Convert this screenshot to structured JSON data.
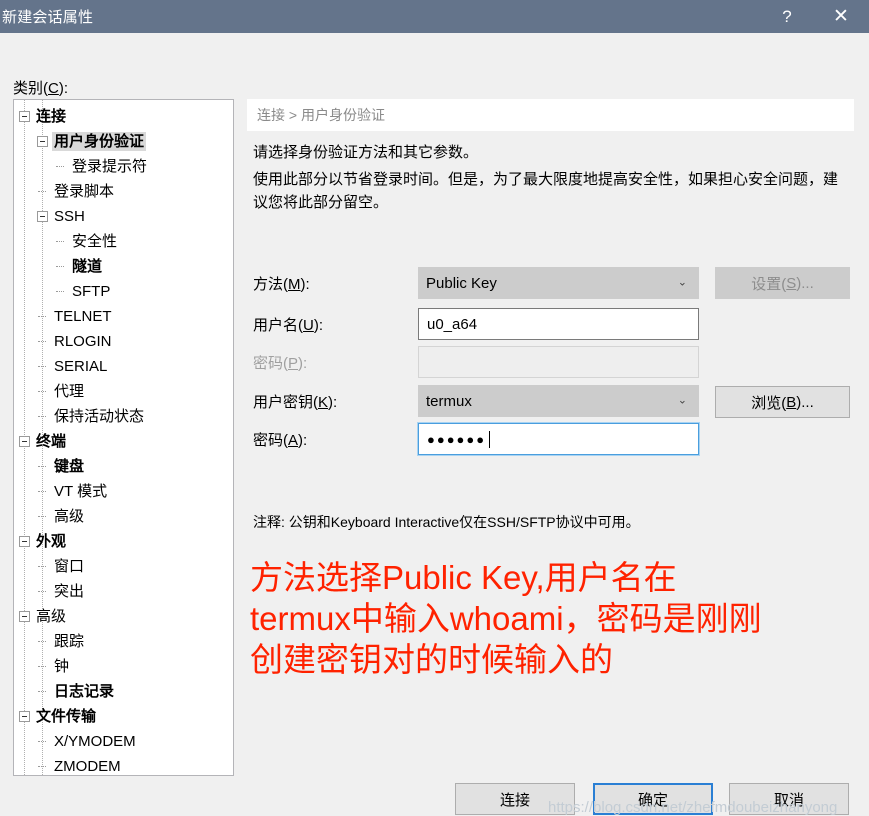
{
  "window": {
    "title": "新建会话属性",
    "help_button": "?",
    "close_button": "✕"
  },
  "category": {
    "label_prefix": "类别(",
    "label_accel": "C",
    "label_suffix": "):"
  },
  "tree": {
    "items": [
      {
        "label": "连接",
        "depth": 0,
        "expander": true,
        "bold": true,
        "selected": false
      },
      {
        "label": "用户身份验证",
        "depth": 1,
        "expander": true,
        "bold": true,
        "selected": true
      },
      {
        "label": "登录提示符",
        "depth": 2,
        "expander": false,
        "bold": false,
        "selected": false
      },
      {
        "label": "登录脚本",
        "depth": 1,
        "expander": false,
        "bold": false,
        "selected": false
      },
      {
        "label": "SSH",
        "depth": 1,
        "expander": true,
        "bold": false,
        "selected": false
      },
      {
        "label": "安全性",
        "depth": 2,
        "expander": false,
        "bold": false,
        "selected": false
      },
      {
        "label": "隧道",
        "depth": 2,
        "expander": false,
        "bold": true,
        "selected": false
      },
      {
        "label": "SFTP",
        "depth": 2,
        "expander": false,
        "bold": false,
        "selected": false
      },
      {
        "label": "TELNET",
        "depth": 1,
        "expander": false,
        "bold": false,
        "selected": false
      },
      {
        "label": "RLOGIN",
        "depth": 1,
        "expander": false,
        "bold": false,
        "selected": false
      },
      {
        "label": "SERIAL",
        "depth": 1,
        "expander": false,
        "bold": false,
        "selected": false
      },
      {
        "label": "代理",
        "depth": 1,
        "expander": false,
        "bold": false,
        "selected": false
      },
      {
        "label": "保持活动状态",
        "depth": 1,
        "expander": false,
        "bold": false,
        "selected": false
      },
      {
        "label": "终端",
        "depth": 0,
        "expander": true,
        "bold": true,
        "selected": false
      },
      {
        "label": "键盘",
        "depth": 1,
        "expander": false,
        "bold": true,
        "selected": false
      },
      {
        "label": "VT 模式",
        "depth": 1,
        "expander": false,
        "bold": false,
        "selected": false
      },
      {
        "label": "高级",
        "depth": 1,
        "expander": false,
        "bold": false,
        "selected": false
      },
      {
        "label": "外观",
        "depth": 0,
        "expander": true,
        "bold": true,
        "selected": false
      },
      {
        "label": "窗口",
        "depth": 1,
        "expander": false,
        "bold": false,
        "selected": false
      },
      {
        "label": "突出",
        "depth": 1,
        "expander": false,
        "bold": false,
        "selected": false
      },
      {
        "label": "高级",
        "depth": 0,
        "expander": true,
        "bold": false,
        "selected": false
      },
      {
        "label": "跟踪",
        "depth": 1,
        "expander": false,
        "bold": false,
        "selected": false
      },
      {
        "label": "钟",
        "depth": 1,
        "expander": false,
        "bold": false,
        "selected": false
      },
      {
        "label": "日志记录",
        "depth": 1,
        "expander": false,
        "bold": true,
        "selected": false
      },
      {
        "label": "文件传输",
        "depth": 0,
        "expander": true,
        "bold": true,
        "selected": false
      },
      {
        "label": "X/YMODEM",
        "depth": 1,
        "expander": false,
        "bold": false,
        "selected": false
      },
      {
        "label": "ZMODEM",
        "depth": 1,
        "expander": false,
        "bold": false,
        "selected": false
      }
    ]
  },
  "pane": {
    "breadcrumb": "连接 > 用户身份验证",
    "desc_line1": "请选择身份验证方法和其它参数。",
    "desc_line2": "使用此部分以节省登录时间。但是，为了最大限度地提高安全性，如果担心安全问题，建议您将此部分留空。",
    "note": "注释: 公钥和Keyboard Interactive仅在SSH/SFTP协议中可用。"
  },
  "form": {
    "method": {
      "label_prefix": "方法(",
      "label_accel": "M",
      "label_suffix": "):",
      "value": "Public Key",
      "chevron": "⌄"
    },
    "username": {
      "label_prefix": "用户名(",
      "label_accel": "U",
      "label_suffix": "):",
      "value": "u0_a64"
    },
    "password": {
      "label_prefix": "密码(",
      "label_accel": "P",
      "label_suffix": "):",
      "value": ""
    },
    "userkey": {
      "label_prefix": "用户密钥(",
      "label_accel": "K",
      "label_suffix": "):",
      "value": "termux",
      "chevron": "⌄"
    },
    "passphrase": {
      "label_prefix": "密码(",
      "label_accel": "A",
      "label_suffix": "):",
      "value": "●●●●●●"
    },
    "settings_button": {
      "prefix": "设置(",
      "accel": "S",
      "suffix": ")..."
    },
    "browse_button": {
      "prefix": "浏览(",
      "accel": "B",
      "suffix": ")..."
    }
  },
  "annotation": {
    "line1": "方法选择Public Key,用户名在",
    "line2": "termux中输入whoami，密码是刚刚",
    "line3": "创建密钥对的时候输入的",
    "color": "#ff2200"
  },
  "footer": {
    "connect": "连接",
    "ok": "确定",
    "cancel": "取消"
  },
  "watermark": "https://blog.csdn.net/zhefmdoubeizhanyong"
}
